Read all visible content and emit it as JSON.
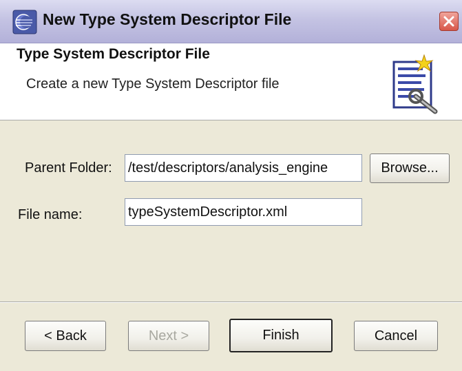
{
  "window": {
    "title": "New Type System Descriptor File",
    "icons": {
      "app": "eclipse-app-icon",
      "close": "close-icon",
      "banner": "descriptor-wizard-icon"
    }
  },
  "banner": {
    "title": "Type System Descriptor File",
    "description": "Create a new Type System Descriptor file"
  },
  "form": {
    "parent_folder_label": "Parent Folder:",
    "parent_folder_value": "/test/descriptors/analysis_engine",
    "file_name_label": "File name:",
    "file_name_value": "typeSystemDescriptor.xml",
    "browse_label": "Browse..."
  },
  "buttons": {
    "back": "< Back",
    "next": "Next >",
    "finish": "Finish",
    "cancel": "Cancel"
  },
  "colors": {
    "titlebar": "#c4c3e3",
    "window_bg": "#ece9d8",
    "banner_bg": "#ffffff",
    "close_red": "#d8574a"
  }
}
